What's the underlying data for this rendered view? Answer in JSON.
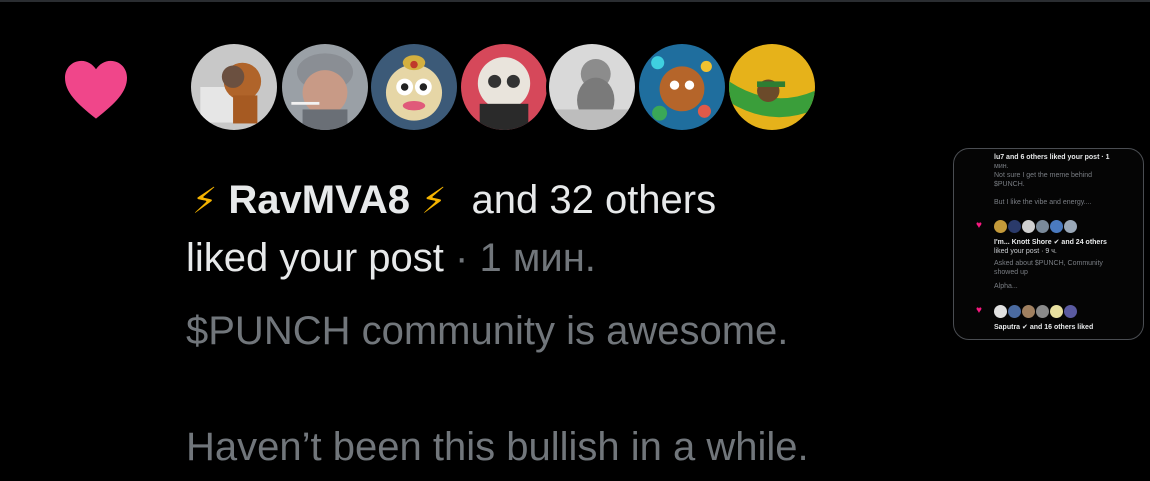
{
  "notification": {
    "icon": "heart-icon",
    "heart_color": "#f0468a",
    "avatars": [
      {
        "name": "avatar-1",
        "color": "#bfbfbf"
      },
      {
        "name": "avatar-2",
        "color": "#a5a5a5"
      },
      {
        "name": "avatar-3",
        "color": "#3c5a78"
      },
      {
        "name": "avatar-4",
        "color": "#d6485a"
      },
      {
        "name": "avatar-5",
        "color": "#d9d9d9"
      },
      {
        "name": "avatar-6",
        "color": "#1f9e5a"
      },
      {
        "name": "avatar-7",
        "color": "#e6b21a"
      }
    ],
    "bolt_left": "⚡",
    "username": "RavMVA8",
    "bolt_right": "⚡",
    "others_text": "and 32 others",
    "action_text": "liked your post",
    "separator": "·",
    "time": "1 мин.",
    "post_line1": "$PUNCH community is awesome.",
    "post_line2": "Haven’t been this bullish in a while."
  },
  "thumbnail": {
    "line1": "lu7 and 6 others liked your post · 1",
    "line2": "мин.",
    "line3": "Not sure I get the meme behind",
    "line4": "$PUNCH.",
    "line5": "But I like the vibe and energy....",
    "line6": "I'm... Knott Shore ✔ and 24 others",
    "line7": "liked your post · 9 ч.",
    "line8": "Asked about $PUNCH, Community",
    "line9": "showed up",
    "line10": "Alpha...",
    "line11": "Saputra ✔ and 16 others liked"
  }
}
